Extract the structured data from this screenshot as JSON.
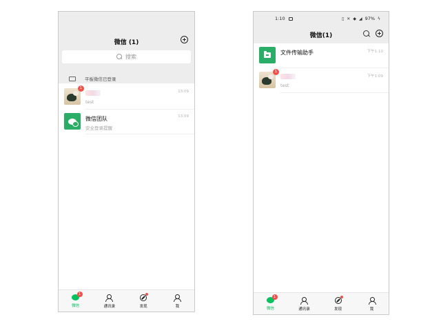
{
  "left": {
    "header": {
      "title": "微信 (1)"
    },
    "search": {
      "placeholder": "搜索"
    },
    "tablet_banner": "平板微信已登录",
    "chats": [
      {
        "name": "",
        "preview": "test",
        "time": "13:09",
        "badge": "1"
      },
      {
        "name": "微信团队",
        "preview": "安全登录提醒",
        "time": "13:09"
      }
    ],
    "tabs": [
      {
        "label": "微信",
        "badge": "1",
        "active": true
      },
      {
        "label": "通讯录"
      },
      {
        "label": "发现",
        "dot": true
      },
      {
        "label": "我"
      }
    ]
  },
  "right": {
    "status": {
      "time": "1:10",
      "battery": "97%"
    },
    "header": {
      "title": "微信(1)"
    },
    "chats": [
      {
        "name": "文件传输助手",
        "preview": "",
        "time": "下午1:10"
      },
      {
        "name": "",
        "preview": "test",
        "time": "下午1:09",
        "badge": "1"
      }
    ],
    "tabs": [
      {
        "label": "微信",
        "badge": "1",
        "active": true
      },
      {
        "label": "通讯录"
      },
      {
        "label": "发现",
        "dot": true
      },
      {
        "label": "我"
      }
    ]
  },
  "colors": {
    "accent": "#07c160",
    "badge": "#f0524b",
    "header_bg": "#ededed"
  }
}
